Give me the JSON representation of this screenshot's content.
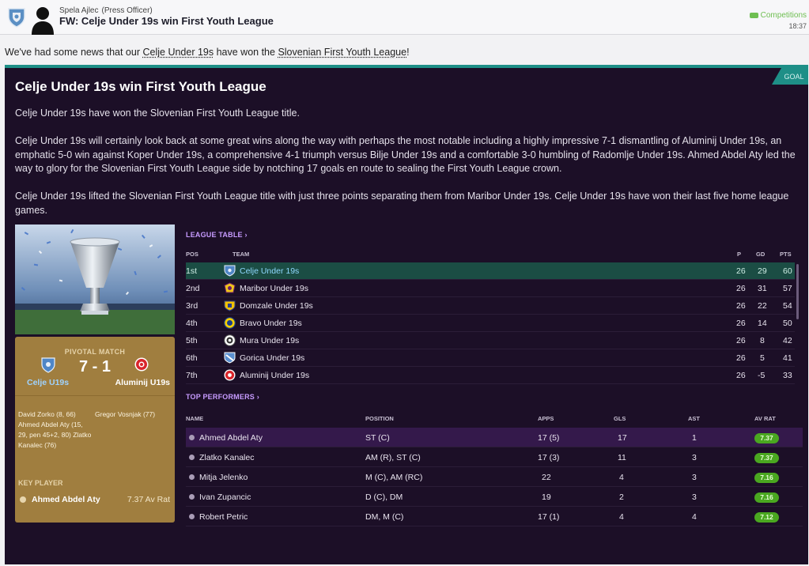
{
  "header": {
    "sender_name": "Spela Ajlec",
    "sender_role": "(Press Officer)",
    "subject": "FW: Celje Under 19s win First Youth League",
    "competitions_link": "Competitions",
    "time": "18:37"
  },
  "intro": {
    "prefix": "We've had some news that our ",
    "team": "Celje Under 19s",
    "middle": " have won the ",
    "competition": "Slovenian First Youth League",
    "suffix": "!"
  },
  "article": {
    "tag": "GOAL",
    "title": "Celje Under 19s win First Youth League",
    "paragraphs": [
      "Celje Under 19s have won the Slovenian First Youth League title.",
      "Celje Under 19s will certainly look back at some great wins along the way with perhaps the most notable including a highly impressive 7-1 dismantling of Aluminij Under 19s, an emphatic 5-0 win against Koper Under 19s, a comprehensive 4-1 triumph versus Bilje Under 19s and a comfortable 3-0 humbling of Radomlje Under 19s. Ahmed Abdel Aty led the way to glory for the Slovenian First Youth League side by notching 17 goals en route to sealing the First Youth League crown.",
      "Celje Under 19s lifted the Slovenian First Youth League title with just three points separating them from Maribor Under 19s. Celje Under 19s have won their last five home league games."
    ]
  },
  "pivotal": {
    "label": "PIVOTAL MATCH",
    "score": "7 - 1",
    "home": "Celje U19s",
    "away": "Aluminij U19s",
    "home_scorers": "David Zorko (8, 66) Ahmed Abdel Aty (15, 29, pen 45+2, 80) Zlatko Kanalec (76)",
    "away_scorers": "Gregor Vosnjak (77)",
    "key_player_label": "KEY PLAYER",
    "key_player_name": "Ahmed Abdel Aty",
    "key_player_rating": "7.37 Av Rat"
  },
  "league_table": {
    "title": "LEAGUE TABLE",
    "columns": {
      "pos": "POS",
      "team": "TEAM",
      "p": "P",
      "gd": "GD",
      "pts": "PTS"
    },
    "rows": [
      {
        "pos": "1st",
        "team": "Celje Under 19s",
        "p": "26",
        "gd": "29",
        "pts": "60"
      },
      {
        "pos": "2nd",
        "team": "Maribor Under 19s",
        "p": "26",
        "gd": "31",
        "pts": "57"
      },
      {
        "pos": "3rd",
        "team": "Domzale Under 19s",
        "p": "26",
        "gd": "22",
        "pts": "54"
      },
      {
        "pos": "4th",
        "team": "Bravo Under 19s",
        "p": "26",
        "gd": "14",
        "pts": "50"
      },
      {
        "pos": "5th",
        "team": "Mura Under 19s",
        "p": "26",
        "gd": "8",
        "pts": "42"
      },
      {
        "pos": "6th",
        "team": "Gorica Under 19s",
        "p": "26",
        "gd": "5",
        "pts": "41"
      },
      {
        "pos": "7th",
        "team": "Aluminij Under 19s",
        "p": "26",
        "gd": "-5",
        "pts": "33"
      }
    ]
  },
  "top_performers": {
    "title": "TOP PERFORMERS",
    "columns": {
      "name": "NAME",
      "position": "POSITION",
      "apps": "APPS",
      "gls": "GLS",
      "ast": "AST",
      "avrat": "AV RAT"
    },
    "rows": [
      {
        "name": "Ahmed Abdel Aty",
        "position": "ST (C)",
        "apps": "17 (5)",
        "gls": "17",
        "ast": "1",
        "avrat": "7.37"
      },
      {
        "name": "Zlatko Kanalec",
        "position": "AM (R), ST (C)",
        "apps": "17 (3)",
        "gls": "11",
        "ast": "3",
        "avrat": "7.37"
      },
      {
        "name": "Mitja Jelenko",
        "position": "M (C), AM (RC)",
        "apps": "22",
        "gls": "4",
        "ast": "3",
        "avrat": "7.16"
      },
      {
        "name": "Ivan Zupancic",
        "position": "D (C), DM",
        "apps": "19",
        "gls": "2",
        "ast": "3",
        "avrat": "7.16"
      },
      {
        "name": "Robert Petric",
        "position": "DM, M (C)",
        "apps": "17 (1)",
        "gls": "4",
        "ast": "4",
        "avrat": "7.12"
      }
    ]
  },
  "colors": {
    "panel": "#1c0f27",
    "accent": "#1e8f87",
    "card": "#a07e3f",
    "rating": "#4aa720",
    "section": "#c79bff"
  }
}
